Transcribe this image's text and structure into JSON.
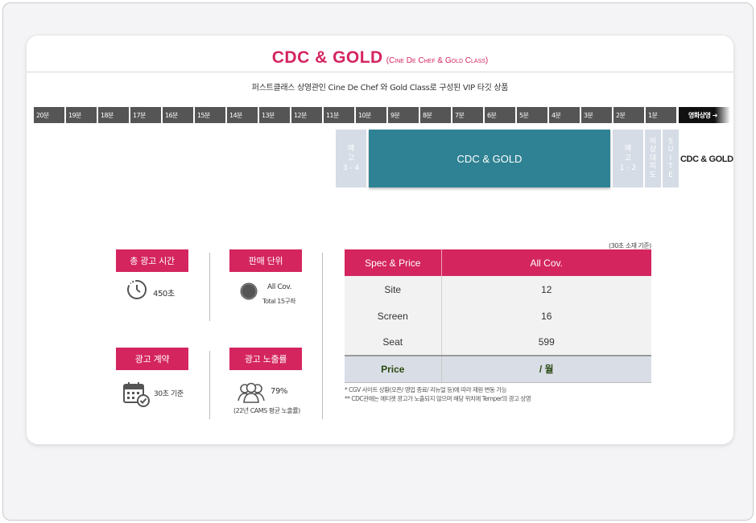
{
  "title": {
    "main": "CDC & GOLD",
    "sub": "(Cine De Chef & Gold Class)"
  },
  "subtitle": "퍼스트클래스 상영관인 Cine De Chef 와 Gold Class로 구성된 VIP 타깃 상품",
  "timeline": {
    "ticks": [
      "20분",
      "19분",
      "18분",
      "17분",
      "16분",
      "15분",
      "14분",
      "13분",
      "12분",
      "11분",
      "10분",
      "9분",
      "8분",
      "7분",
      "6분",
      "5분",
      "4분",
      "3분",
      "2분",
      "1분"
    ],
    "start_label": "영화상영 ➔"
  },
  "blocks": {
    "preview_34": "예\n고\n3 - 4",
    "main": "CDC & GOLD",
    "preview_12": "예\n고\n1 - 2",
    "emergency": "비\n상\n대\n피\n도",
    "suite": "S\nU\nI\nT\nE",
    "right_label": "CDC & GOLD"
  },
  "info": {
    "total_time_label": "총 광고 시간",
    "total_time_value": "450초",
    "sales_unit_label": "판매 단위",
    "sales_unit_value": "All Cov.",
    "sales_unit_sub": "Total 15구좌",
    "contract_label": "광고 계약",
    "contract_value": "30초 기준",
    "exposure_label": "광고 노출률",
    "exposure_value": "79%",
    "exposure_note": "(22년 CAMS 평균 노출률)"
  },
  "table": {
    "note": "(30초 소재 기준)",
    "header": [
      "Spec & Price",
      "All Cov."
    ],
    "rows": [
      [
        "Site",
        "12"
      ],
      [
        "Screen",
        "16"
      ],
      [
        "Seat",
        "599"
      ]
    ],
    "price": [
      "Price",
      "/ 월"
    ]
  },
  "footnotes": [
    "* CGV 사이트 상황(오픈/ 영업 종료/ 리뉴얼 등)에 따라 재원 변동 가능",
    "** CDC관에는 에티켓 광고가 노출되지 않으며 해당 위치에 Temper의 광고 상영"
  ],
  "colors": {
    "accent": "#d4255f",
    "teal": "#2f8293",
    "tick": "#555555"
  },
  "icons": [
    "stopwatch-icon",
    "film-reel-icon",
    "calendar-check-icon",
    "audience-icon"
  ]
}
